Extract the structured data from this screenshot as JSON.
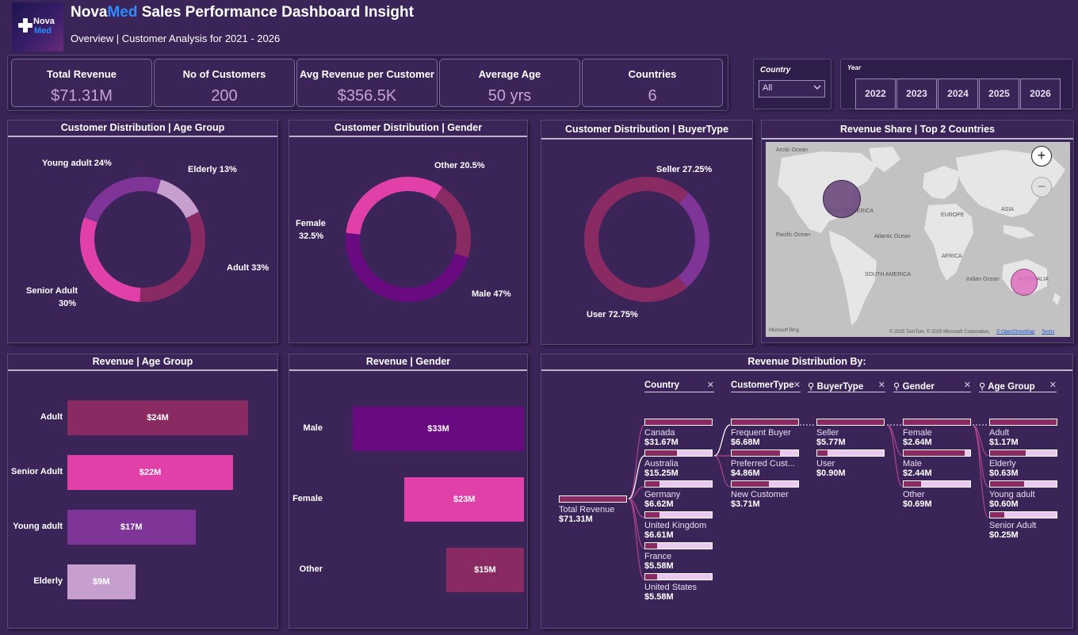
{
  "header": {
    "logo_line1": "Nova",
    "logo_line2": "Med",
    "title_part1": "Nova",
    "title_part2": "Med",
    "title_rest": " Sales Performance Dashboard Insight",
    "subtitle": "Overview | Customer Analysis for 2021 - 2026"
  },
  "kpis": [
    {
      "label": "Total Revenue",
      "value": "$71.31M"
    },
    {
      "label": "No of Customers",
      "value": "200"
    },
    {
      "label": "Avg Revenue per Customer",
      "value": "$356.5K"
    },
    {
      "label": "Average Age",
      "value": "50 yrs"
    },
    {
      "label": "Countries",
      "value": "6"
    }
  ],
  "slicers": {
    "country": {
      "label": "Country",
      "selected": "All"
    },
    "year": {
      "label": "Year",
      "options": [
        "2022",
        "2023",
        "2024",
        "2025",
        "2026"
      ]
    }
  },
  "panels": {
    "age_dist": "Customer Distribution | Age Group",
    "gender_dist": "Customer Distribution | Gender",
    "buyer_dist": "Customer Distribution | BuyerType",
    "map": "Revenue Share | Top 2 Countries",
    "rev_age": "Revenue | Age Group",
    "rev_gender": "Revenue | Gender",
    "decomp": "Revenue Distribution By:"
  },
  "chart_data": [
    {
      "type": "pie",
      "title": "Customer Distribution | Age Group",
      "categories": [
        "Elderly",
        "Adult",
        "Senior Adult",
        "Young adult"
      ],
      "values": [
        13,
        33,
        30,
        24
      ],
      "labels": [
        "Elderly 13%",
        "Adult 33%",
        "Senior Adult",
        "30%",
        "Young adult 24%"
      ],
      "colors": [
        "#c79fcf",
        "#8a2a62",
        "#e040a8",
        "#7e3597"
      ]
    },
    {
      "type": "pie",
      "title": "Customer Distribution | Gender",
      "categories": [
        "Other",
        "Male",
        "Female"
      ],
      "values": [
        20.5,
        47,
        32.5
      ],
      "labels": [
        "Other 20.5%",
        "Male 47%",
        "Female",
        "32.5%"
      ],
      "colors": [
        "#8a2a62",
        "#6a0a80",
        "#e040a8"
      ]
    },
    {
      "type": "pie",
      "title": "Customer Distribution | BuyerType",
      "categories": [
        "Seller",
        "User"
      ],
      "values": [
        27.25,
        72.75
      ],
      "labels": [
        "Seller 27.25%",
        "User 72.75%"
      ],
      "colors": [
        "#7e3597",
        "#8a2a62"
      ]
    },
    {
      "type": "bar",
      "title": "Revenue | Age Group",
      "categories": [
        "Adult",
        "Senior Adult",
        "Young adult",
        "Elderly"
      ],
      "values": [
        24,
        22,
        17,
        9
      ],
      "value_labels": [
        "$24M",
        "$22M",
        "$17M",
        "$9M"
      ],
      "colors": [
        "#8a2a62",
        "#e040a8",
        "#7e3597",
        "#c79fcf"
      ]
    },
    {
      "type": "bar",
      "title": "Revenue | Gender",
      "categories": [
        "Male",
        "Female",
        "Other"
      ],
      "values": [
        33,
        23,
        15
      ],
      "value_labels": [
        "$33M",
        "$23M",
        "$15M"
      ],
      "colors": [
        "#6a0a80",
        "#e040a8",
        "#8a2a62"
      ]
    }
  ],
  "map": {
    "labels": {
      "arctic": "Arctic Ocean",
      "north_america": "NORTH AMERICA",
      "europe": "EUROPE",
      "asia": "ASIA",
      "pacific": "Pacific Ocean",
      "atlantic": "Atlantic Ocean",
      "africa": "AFRICA",
      "south_america": "SOUTH AMERICA",
      "indian": "Indian Ocean",
      "australia": "AUSTRALIA"
    },
    "bubbles": [
      {
        "country": "Canada",
        "color": "#7a5a8a"
      },
      {
        "country": "Australia",
        "color": "#e070c0"
      }
    ],
    "credit": "© 2025 TomTom, © 2025 Microsoft Corporation,",
    "osm": "© OpenStreetMap",
    "terms": "Terms",
    "bing": "Microsoft Bing",
    "zoom_in": "+",
    "zoom_out": "−"
  },
  "decomp": {
    "root": {
      "label": "Total Revenue",
      "value": "$71.31M"
    },
    "headers": [
      "Country",
      "CustomerType",
      "BuyerType",
      "Gender",
      "Age Group"
    ],
    "country": [
      {
        "label": "Canada",
        "value": "$31.67M",
        "share": 1.0
      },
      {
        "label": "Australia",
        "value": "$15.25M",
        "share": 0.48
      },
      {
        "label": "Germany",
        "value": "$6.62M",
        "share": 0.21
      },
      {
        "label": "United Kingdom",
        "value": "$6.61M",
        "share": 0.21
      },
      {
        "label": "France",
        "value": "$5.58M",
        "share": 0.18
      },
      {
        "label": "United States",
        "value": "$5.58M",
        "share": 0.18
      }
    ],
    "customer_type": [
      {
        "label": "Frequent Buyer",
        "value": "$6.68M",
        "share": 1.0
      },
      {
        "label": "Preferred Cust...",
        "value": "$4.86M",
        "share": 0.73
      },
      {
        "label": "New Customer",
        "value": "$3.71M",
        "share": 0.56
      }
    ],
    "buyer_type": [
      {
        "label": "Seller",
        "value": "$5.77M",
        "share": 1.0
      },
      {
        "label": "User",
        "value": "$0.90M",
        "share": 0.16
      }
    ],
    "gender": [
      {
        "label": "Female",
        "value": "$2.64M",
        "share": 1.0
      },
      {
        "label": "Male",
        "value": "$2.44M",
        "share": 0.92
      },
      {
        "label": "Other",
        "value": "$0.69M",
        "share": 0.26
      }
    ],
    "age_group": [
      {
        "label": "Adult",
        "value": "$1.17M",
        "share": 1.0
      },
      {
        "label": "Elderly",
        "value": "$0.63M",
        "share": 0.54
      },
      {
        "label": "Young adult",
        "value": "$0.60M",
        "share": 0.51
      },
      {
        "label": "Senior Adult",
        "value": "$0.25M",
        "share": 0.21
      }
    ]
  }
}
